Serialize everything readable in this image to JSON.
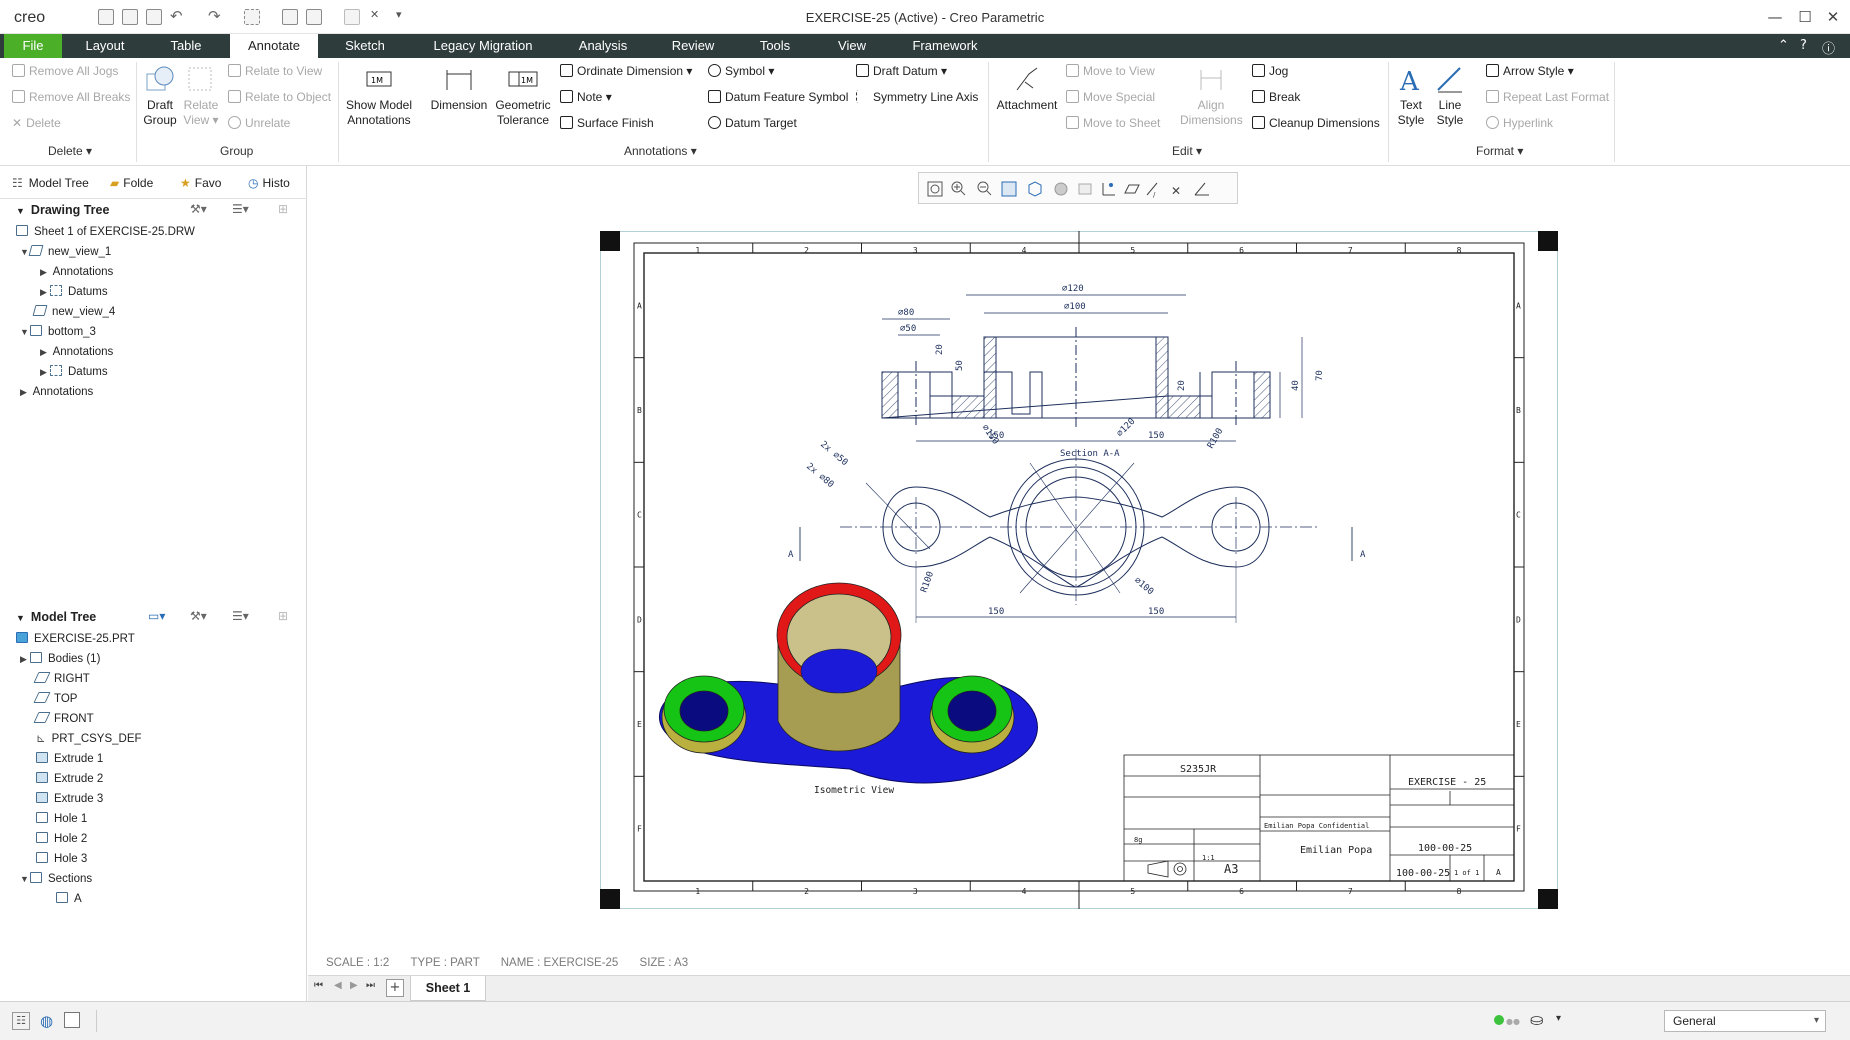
{
  "app": {
    "logo": "creo",
    "title": "EXERCISE-25 (Active) - Creo Parametric"
  },
  "tabs": [
    "File",
    "Layout",
    "Table",
    "Annotate",
    "Sketch",
    "Legacy Migration",
    "Analysis",
    "Review",
    "Tools",
    "View",
    "Framework"
  ],
  "ribbon": {
    "delete_group": {
      "remove_all_jogs": "Remove All Jogs",
      "remove_all_breaks": "Remove All Breaks",
      "delete": "Delete",
      "label": "Delete"
    },
    "group_group": {
      "draft_group": "Draft Group",
      "relate_view": "Relate View",
      "relate_to_view": "Relate to View",
      "relate_to_object": "Relate to Object",
      "unrelate": "Unrelate",
      "label": "Group"
    },
    "annotations_group": {
      "show_model_annotations": "Show Model Annotations",
      "dimension": "Dimension",
      "geometric_tolerance": "Geometric Tolerance",
      "ordinate_dimension": "Ordinate Dimension",
      "note": "Note",
      "surface_finish": "Surface Finish",
      "symbol": "Symbol",
      "datum_feature_symbol": "Datum Feature Symbol",
      "datum_target": "Datum Target",
      "draft_datum": "Draft Datum",
      "symmetry_line_axis": "Symmetry Line Axis",
      "label": "Annotations"
    },
    "edit_group": {
      "attachment": "Attachment",
      "move_to_view": "Move to View",
      "move_special": "Move Special",
      "move_to_sheet": "Move to Sheet",
      "align_dimensions": "Align Dimensions",
      "jog": "Jog",
      "break": "Break",
      "cleanup_dimensions": "Cleanup Dimensions",
      "label": "Edit"
    },
    "format_group": {
      "text_style": "Text Style",
      "line_style": "Line Style",
      "arrow_style": "Arrow Style",
      "repeat_last_format": "Repeat Last Format",
      "hyperlink": "Hyperlink",
      "label": "Format"
    }
  },
  "left_tabs": [
    "Model Tree",
    "Folde",
    "Favo",
    "Histo"
  ],
  "drawing_tree": {
    "title": "Drawing Tree",
    "items": [
      "Sheet 1 of EXERCISE-25.DRW",
      "new_view_1",
      "Annotations",
      "Datums",
      "new_view_4",
      "bottom_3",
      "Annotations",
      "Datums",
      "Annotations"
    ]
  },
  "model_tree": {
    "title": "Model Tree",
    "items": [
      "EXERCISE-25.PRT",
      "Bodies (1)",
      "RIGHT",
      "TOP",
      "FRONT",
      "PRT_CSYS_DEF",
      "Extrude 1",
      "Extrude 2",
      "Extrude 3",
      "Hole 1",
      "Hole 2",
      "Hole 3",
      "Sections",
      "A"
    ]
  },
  "drawing": {
    "border_cols": [
      "1",
      "2",
      "3",
      "4",
      "5",
      "6",
      "7",
      "8"
    ],
    "border_rows": [
      "A",
      "B",
      "C",
      "D",
      "E",
      "F"
    ],
    "section_label": "Section A-A",
    "section_dims": [
      "⌀120",
      "⌀100",
      "⌀80",
      "⌀50",
      "20",
      "50",
      "40",
      "70",
      "20",
      "150",
      "150"
    ],
    "top_dims": [
      "2x ⌀50",
      "2x ⌀80",
      "⌀150",
      "⌀120",
      "R100",
      "R100",
      "⌀100",
      "150",
      "150"
    ],
    "section_arrow": "A",
    "iso_label": "Isometric View",
    "title_block": {
      "material": "S235JR",
      "exercise": "EXERCISE - 25",
      "company": "Emilian Popa",
      "confidential": "Emilian Popa Confidential",
      "part_number": "100-00-25",
      "drawing_number": "100-00-25",
      "sheet_size": "A3",
      "scale": "1:1",
      "mass": "8g",
      "sheet": "1 of 1",
      "revision": "A"
    }
  },
  "docinfo": {
    "scale": "SCALE : 1:2",
    "type": "TYPE : PART",
    "name": "NAME : EXERCISE-25",
    "size": "SIZE : A3"
  },
  "sheet_tab": "Sheet 1",
  "filter": "General"
}
